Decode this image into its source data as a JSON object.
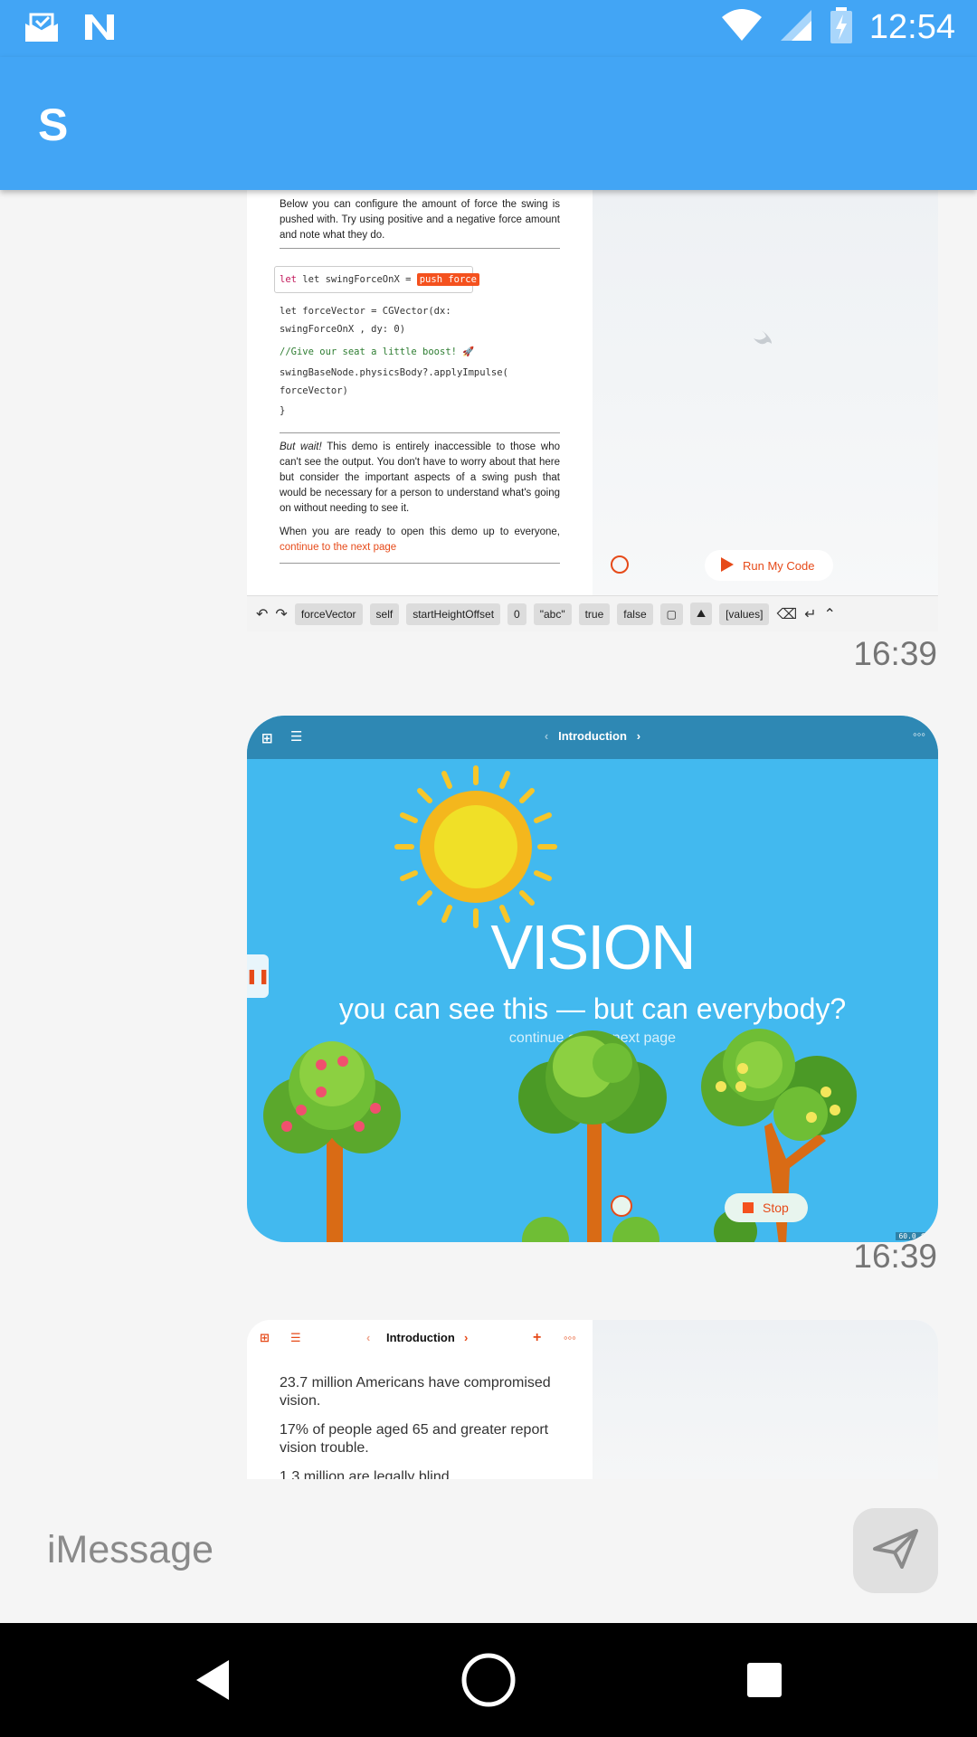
{
  "status_bar": {
    "time": "12:54",
    "icons": [
      "mail-done-icon",
      "n-notification-icon",
      "wifi-icon",
      "signal-icon",
      "battery-charging-icon"
    ],
    "color": "#42a5f5"
  },
  "app_bar": {
    "title": "S",
    "color": "#42a5f5"
  },
  "messages": [
    {
      "kind": "code-editor-screenshot",
      "intro": "Below you can configure the amount of force the swing is pushed with. Try using positive and a negative force amount and note what they do.",
      "code": {
        "line1_prefix": "let swingForceOnX =",
        "line1_token": "push force",
        "line2": "let forceVector = CGVector(dx:",
        "line3": " swingForceOnX , dy: 0)",
        "line4": "//Give our seat a little boost! 🚀",
        "line5": "swingBaseNode.physicsBody?.applyImpulse(",
        "line6": " forceVector)",
        "line7": "}"
      },
      "warning_em": "But wait!",
      "warning": " This demo is entirely inaccessible to those who can't see the output. You don't have to worry about that here but consider the important aspects of a swing push that would be necessary for a person to understand what's going on without needing to see it.",
      "ready": "When you are ready to open this demo up to everyone,",
      "ready_link": "continue to the next page",
      "run_button": "Run My Code",
      "shortcuts": [
        "forceVector",
        "self",
        "startHeightOffset",
        "0",
        "\"abc\"",
        "true",
        "false",
        "[values]"
      ],
      "timestamp": "16:39"
    },
    {
      "kind": "playground-screenshot",
      "nav_title": "Introduction",
      "heading": "VISION",
      "subtitle": "you can see this — but can everybody?",
      "hint": "continue on the next page",
      "stop_button": "Stop",
      "fps": "60.0 fps",
      "timestamp": "16:39"
    },
    {
      "kind": "stats-screenshot",
      "nav_title": "Introduction",
      "stats": [
        "23.7 million Americans have compromised vision.",
        "17% of people aged 65 and greater report vision trouble.",
        "1.3 million are legally blind."
      ]
    }
  ],
  "input": {
    "placeholder": "iMessage"
  },
  "accent": {
    "orange": "#e64a19",
    "sky": "#42b9ef"
  }
}
